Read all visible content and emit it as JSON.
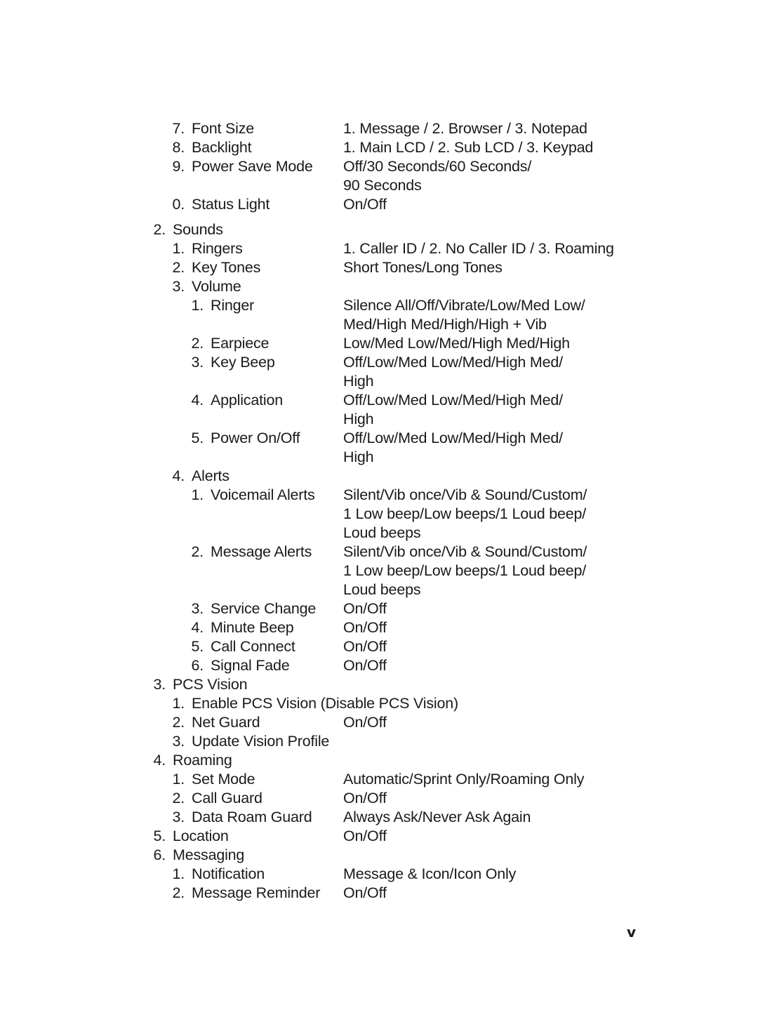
{
  "menu": [
    {
      "level": 1,
      "num": "7.",
      "label": "Font Size",
      "value": "1. Message / 2. Browser / 3. Notepad"
    },
    {
      "level": 1,
      "num": "8.",
      "label": "Backlight",
      "value": "1. Main LCD / 2. Sub LCD / 3. Keypad"
    },
    {
      "level": 1,
      "num": "9.",
      "label": "Power Save Mode",
      "value": "Off/30 Seconds/60 Seconds/\n90 Seconds"
    },
    {
      "level": 1,
      "num": "0.",
      "label": "Status Light",
      "value": "On/Off"
    },
    {
      "level": 0,
      "num": "2.",
      "label": "Sounds",
      "value": "",
      "gap": true
    },
    {
      "level": 1,
      "num": "1.",
      "label": "Ringers",
      "value": "1. Caller ID / 2. No Caller ID / 3. Roaming"
    },
    {
      "level": 1,
      "num": "2.",
      "label": "Key Tones",
      "value": "Short Tones/Long Tones"
    },
    {
      "level": 1,
      "num": "3.",
      "label": "Volume",
      "value": ""
    },
    {
      "level": 2,
      "num": "1.",
      "label": "Ringer",
      "value": "Silence All/Off/Vibrate/Low/Med Low/\nMed/High Med/High/High + Vib"
    },
    {
      "level": 2,
      "num": "2.",
      "label": "Earpiece",
      "value": "Low/Med Low/Med/High Med/High"
    },
    {
      "level": 2,
      "num": "3.",
      "label": "Key Beep",
      "value": "Off/Low/Med Low/Med/High Med/\nHigh"
    },
    {
      "level": 2,
      "num": "4.",
      "label": "Application",
      "value": "Off/Low/Med Low/Med/High Med/\nHigh"
    },
    {
      "level": 2,
      "num": "5.",
      "label": "Power On/Off",
      "value": "Off/Low/Med Low/Med/High Med/\nHigh"
    },
    {
      "level": 1,
      "num": "4.",
      "label": "Alerts",
      "value": ""
    },
    {
      "level": 2,
      "num": "1.",
      "label": "Voicemail Alerts",
      "value": "Silent/Vib once/Vib & Sound/Custom/\n1 Low beep/Low beeps/1 Loud beep/\nLoud beeps"
    },
    {
      "level": 2,
      "num": "2.",
      "label": "Message Alerts",
      "value": "Silent/Vib once/Vib & Sound/Custom/\n1 Low beep/Low beeps/1 Loud beep/\nLoud beeps"
    },
    {
      "level": 2,
      "num": "3.",
      "label": "Service Change",
      "value": "On/Off"
    },
    {
      "level": 2,
      "num": "4.",
      "label": "Minute Beep",
      "value": "On/Off"
    },
    {
      "level": 2,
      "num": "5.",
      "label": "Call Connect",
      "value": "On/Off"
    },
    {
      "level": 2,
      "num": "6.",
      "label": "Signal Fade",
      "value": "On/Off"
    },
    {
      "level": 0,
      "num": "3.",
      "label": "PCS Vision",
      "value": ""
    },
    {
      "level": 1,
      "num": "1.",
      "label": "Enable PCS Vision (Disable PCS Vision)",
      "value": ""
    },
    {
      "level": 1,
      "num": "2.",
      "label": "Net Guard",
      "value": "On/Off"
    },
    {
      "level": 1,
      "num": "3.",
      "label": "Update Vision Profile",
      "value": ""
    },
    {
      "level": 0,
      "num": "4.",
      "label": "Roaming",
      "value": ""
    },
    {
      "level": 1,
      "num": "1.",
      "label": "Set Mode",
      "value": "Automatic/Sprint Only/Roaming Only"
    },
    {
      "level": 1,
      "num": "2.",
      "label": "Call Guard",
      "value": "On/Off"
    },
    {
      "level": 1,
      "num": "3.",
      "label": "Data Roam Guard",
      "value": "Always Ask/Never Ask Again"
    },
    {
      "level": 0,
      "num": "5.",
      "label": "Location",
      "value": "On/Off"
    },
    {
      "level": 0,
      "num": "6.",
      "label": "Messaging",
      "value": ""
    },
    {
      "level": 1,
      "num": "1.",
      "label": "Notification",
      "value": "Message & Icon/Icon Only"
    },
    {
      "level": 1,
      "num": "2.",
      "label": "Message Reminder",
      "value": "On/Off"
    }
  ],
  "footer": {
    "page_number": "v"
  }
}
